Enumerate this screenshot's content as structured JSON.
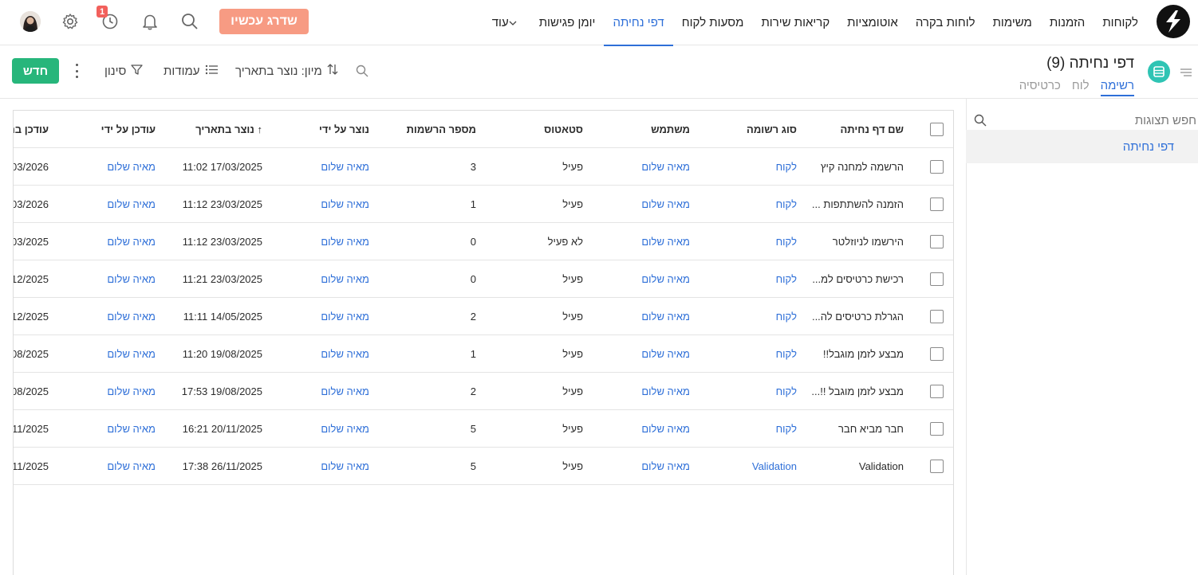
{
  "nav": {
    "items": [
      {
        "label": "לקוחות",
        "active": false
      },
      {
        "label": "הזמנות",
        "active": false
      },
      {
        "label": "משימות",
        "active": false
      },
      {
        "label": "לוחות בקרה",
        "active": false
      },
      {
        "label": "אוטומציות",
        "active": false
      },
      {
        "label": "קריאות שירות",
        "active": false
      },
      {
        "label": "מסעות לקוח",
        "active": false
      },
      {
        "label": "דפי נחיתה",
        "active": true
      },
      {
        "label": "יומן פגישות",
        "active": false
      }
    ],
    "more_label": "עוד",
    "upgrade_label": "שדרג עכשיו",
    "history_badge": "1"
  },
  "page": {
    "title": "דפי נחיתה (9)",
    "tabs": [
      "רשימה",
      "לוח",
      "כרטיסיה"
    ],
    "active_tab": "רשימה"
  },
  "toolbar": {
    "new_label": "חדש",
    "filter_label": "סינון",
    "columns_label": "עמודות",
    "sort_label": "מיון: נוצר בתאריך"
  },
  "sidebar": {
    "search_placeholder": "חפש תצוגות",
    "views": [
      "דפי נחיתה"
    ]
  },
  "table": {
    "columns": [
      "שם דף נחיתה",
      "סוג רשומה",
      "משתמש",
      "סטאטוס",
      "מספר הרשמות",
      "נוצר על ידי",
      "↑ נוצר בתאריך",
      "עודכן על ידי",
      "עודכן בת"
    ],
    "rows": [
      {
        "name": "הרשמה למחנה קיץ",
        "type": "לקוח",
        "user": "מאיה שלום",
        "status": "פעיל",
        "count": "3",
        "created_by": "מאיה שלום",
        "created": "17/03/2025 11:02",
        "updated_by": "מאיה שלום",
        "updated": "03/2026"
      },
      {
        "name": "הזמנה להשתתפות ...",
        "type": "לקוח",
        "user": "מאיה שלום",
        "status": "פעיל",
        "count": "1",
        "created_by": "מאיה שלום",
        "created": "23/03/2025 11:12",
        "updated_by": "מאיה שלום",
        "updated": "03/2026"
      },
      {
        "name": "הירשמו לניוזלטר",
        "type": "לקוח",
        "user": "מאיה שלום",
        "status": "לא פעיל",
        "count": "0",
        "created_by": "מאיה שלום",
        "created": "23/03/2025 11:12",
        "updated_by": "מאיה שלום",
        "updated": "03/2025"
      },
      {
        "name": "רכישת כרטיסים למ...",
        "type": "לקוח",
        "user": "מאיה שלום",
        "status": "פעיל",
        "count": "0",
        "created_by": "מאיה שלום",
        "created": "23/03/2025 11:21",
        "updated_by": "מאיה שלום",
        "updated": "12/2025"
      },
      {
        "name": "הגרלת כרטיסים לה...",
        "type": "לקוח",
        "user": "מאיה שלום",
        "status": "פעיל",
        "count": "2",
        "created_by": "מאיה שלום",
        "created": "14/05/2025 11:11",
        "updated_by": "מאיה שלום",
        "updated": "12/2025"
      },
      {
        "name": "מבצע לזמן מוגבל!!",
        "type": "לקוח",
        "user": "מאיה שלום",
        "status": "פעיל",
        "count": "1",
        "created_by": "מאיה שלום",
        "created": "19/08/2025 11:20",
        "updated_by": "מאיה שלום",
        "updated": "08/2025"
      },
      {
        "name": "מבצע לזמן מוגבל !!...",
        "type": "לקוח",
        "user": "מאיה שלום",
        "status": "פעיל",
        "count": "2",
        "created_by": "מאיה שלום",
        "created": "19/08/2025 17:53",
        "updated_by": "מאיה שלום",
        "updated": "08/2025"
      },
      {
        "name": "חבר מביא חבר",
        "type": "לקוח",
        "user": "מאיה שלום",
        "status": "פעיל",
        "count": "5",
        "created_by": "מאיה שלום",
        "created": "20/11/2025 16:21",
        "updated_by": "מאיה שלום",
        "updated": "11/2025"
      },
      {
        "name": "Validation",
        "type": "Validation",
        "user": "מאיה שלום",
        "status": "פעיל",
        "count": "5",
        "created_by": "מאיה שלום",
        "created": "26/11/2025 17:38",
        "updated_by": "מאיה שלום",
        "updated": "11/2025"
      }
    ]
  },
  "colors": {
    "accent": "#2e6fd8",
    "new_button": "#27b67b",
    "upgrade_button": "#f79b83",
    "badge": "#f2605c",
    "page_icon": "#2fc4b4"
  }
}
